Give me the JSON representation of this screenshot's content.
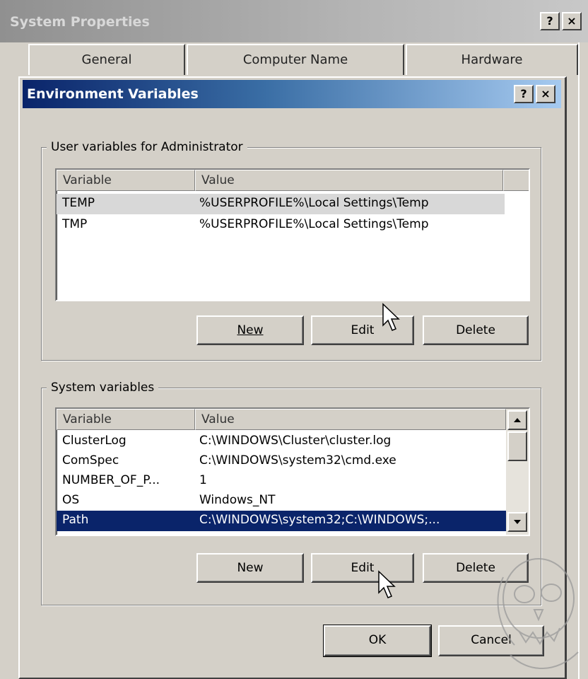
{
  "system_properties": {
    "title": "System Properties",
    "help_label": "?",
    "close_label": "×",
    "tabs": [
      "General",
      "Computer Name",
      "Hardware"
    ]
  },
  "env_dialog": {
    "title": "Environment Variables",
    "help_label": "?",
    "close_label": "×",
    "user_group_label": "User variables for Administrator",
    "system_group_label": "System variables",
    "columns": [
      "Variable",
      "Value"
    ],
    "user_vars": [
      {
        "variable": "TEMP",
        "value": "%USERPROFILE%\\Local Settings\\Temp"
      },
      {
        "variable": "TMP",
        "value": "%USERPROFILE%\\Local Settings\\Temp"
      }
    ],
    "system_vars": [
      {
        "variable": "ClusterLog",
        "value": "C:\\WINDOWS\\Cluster\\cluster.log"
      },
      {
        "variable": "ComSpec",
        "value": "C:\\WINDOWS\\system32\\cmd.exe"
      },
      {
        "variable": "NUMBER_OF_P...",
        "value": "1"
      },
      {
        "variable": "OS",
        "value": "Windows_NT"
      },
      {
        "variable": "Path",
        "value": "C:\\WINDOWS\\system32;C:\\WINDOWS;..."
      }
    ],
    "user_buttons": {
      "new": "New",
      "edit": "Edit",
      "delete": "Delete"
    },
    "system_buttons": {
      "new": "New",
      "edit": "Edit",
      "delete": "Delete"
    },
    "ok_label": "OK",
    "cancel_label": "Cancel"
  },
  "colors": {
    "title_active": "#0a246a",
    "selection": "#0a246a",
    "dialog_face": "#d4d0c8"
  }
}
